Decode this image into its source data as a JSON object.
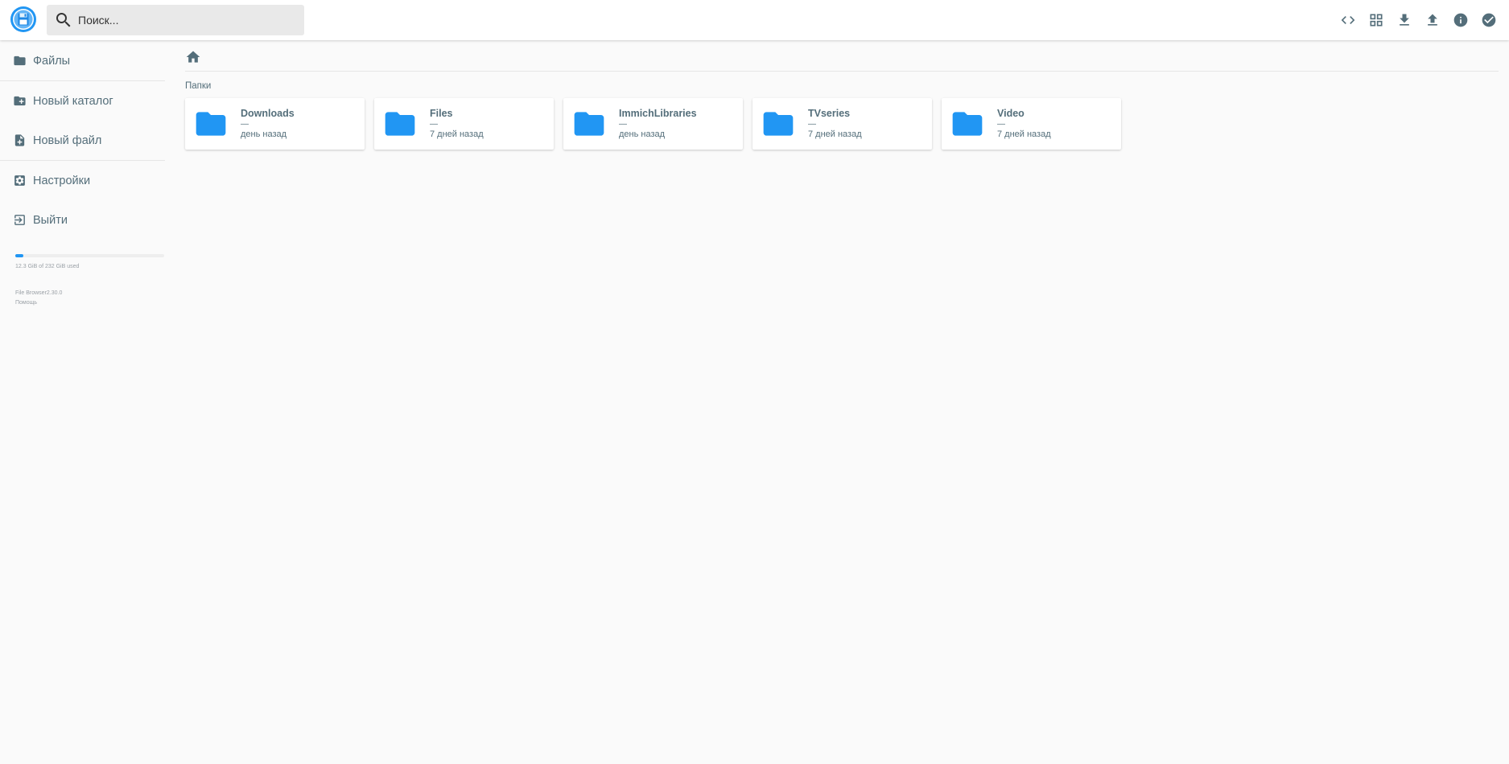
{
  "header": {
    "search_placeholder": "Поиск...",
    "toolbar": [
      {
        "icon": "code-icon"
      },
      {
        "icon": "grid-view-icon"
      },
      {
        "icon": "download-icon"
      },
      {
        "icon": "upload-icon"
      },
      {
        "icon": "info-icon"
      },
      {
        "icon": "check-circle-icon"
      }
    ]
  },
  "sidebar": {
    "items": [
      {
        "label": "Файлы",
        "icon": "folder-icon"
      },
      {
        "label": "Новый каталог",
        "icon": "create-folder-icon"
      },
      {
        "label": "Новый файл",
        "icon": "note-add-icon"
      },
      {
        "label": "Настройки",
        "icon": "settings-icon"
      },
      {
        "label": "Выйти",
        "icon": "exit-icon"
      }
    ],
    "usage": {
      "text": "12.3 GiB of 232 GiB used",
      "fraction": 0.053
    },
    "credits": {
      "app": "File Browser",
      "version": "2.30.0",
      "help": "Помощь"
    }
  },
  "main": {
    "section_title": "Папки",
    "folders": [
      {
        "name": "Downloads",
        "size": "—",
        "modified": "день назад"
      },
      {
        "name": "Files",
        "size": "—",
        "modified": "7 дней назад"
      },
      {
        "name": "ImmichLibraries",
        "size": "—",
        "modified": "день назад"
      },
      {
        "name": "TVseries",
        "size": "—",
        "modified": "7 дней назад"
      },
      {
        "name": "Video",
        "size": "—",
        "modified": "7 дней назад"
      }
    ]
  },
  "colors": {
    "accent": "#2196f3",
    "icon": "#546e7a",
    "background": "#fafafa"
  }
}
